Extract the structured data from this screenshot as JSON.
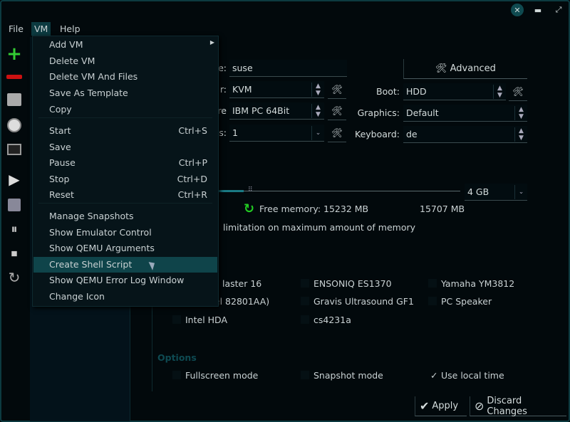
{
  "window": {
    "close_icon": "close-icon",
    "minimize_icon": "minimize-icon",
    "maximize_icon": "maximize-icon",
    "accent": "#0f444a"
  },
  "menubar": {
    "file": "File",
    "vm": "VM",
    "help": "Help"
  },
  "toolbar": {
    "icons": [
      "add-icon",
      "remove-icon",
      "hard-disk-icon",
      "clock-icon",
      "terminal-icon",
      "play-icon",
      "save-icon",
      "pause-icon",
      "stop-icon",
      "reset-icon"
    ]
  },
  "vm_menu": {
    "items": [
      {
        "label": "Add VM",
        "shortcut": "",
        "submenu": true
      },
      {
        "label": "Delete VM",
        "shortcut": ""
      },
      {
        "label": "Delete VM And Files",
        "shortcut": ""
      },
      {
        "label": "Save As Template",
        "shortcut": ""
      },
      {
        "label": "Copy",
        "shortcut": ""
      },
      {
        "label": "Start",
        "shortcut": "Ctrl+S"
      },
      {
        "label": "Save",
        "shortcut": ""
      },
      {
        "label": "Pause",
        "shortcut": "Ctrl+P"
      },
      {
        "label": "Stop",
        "shortcut": "Ctrl+D"
      },
      {
        "label": "Reset",
        "shortcut": "Ctrl+R"
      },
      {
        "label": "Manage Snapshots",
        "shortcut": ""
      },
      {
        "label": "Show Emulator Control",
        "shortcut": ""
      },
      {
        "label": "Show QEMU Arguments",
        "shortcut": ""
      },
      {
        "label": "Create Shell Script",
        "shortcut": "",
        "highlighted": true
      },
      {
        "label": "Show QEMU Error Log Window",
        "shortcut": ""
      },
      {
        "label": "Change Icon",
        "shortcut": ""
      }
    ]
  },
  "form": {
    "name_label_fragment": "e:",
    "name_value": "suse",
    "emulator_label_fragment": "r:",
    "emulator_value": "KVM",
    "machine_label_fragment": "re",
    "machine_value": "IBM PC 64Bit",
    "cpu_label_fragment": "s:",
    "cpu_value": "1",
    "advanced_button": "Advanced",
    "boot_label": "Boot:",
    "boot_value": "HDD",
    "graphics_label": "Graphics:",
    "graphics_value": "Default",
    "keyboard_label": "Keyboard:",
    "keyboard_value": "de"
  },
  "memory": {
    "value": "4 GB",
    "free_memory": "Free memory: 15232 MB",
    "max": "15707 MB",
    "limit_text_fragment": "limitation on maximum amount of memory",
    "slider_fraction": 0.26
  },
  "audio": {
    "items": [
      {
        "label": "laster 16",
        "checked": false
      },
      {
        "label": "ENSONIQ ES1370",
        "checked": false
      },
      {
        "label": "Yamaha YM3812",
        "checked": false
      },
      {
        "label": "tel 82801AA)",
        "checked": false
      },
      {
        "label": "Gravis Ultrasound GF1",
        "checked": false
      },
      {
        "label": "PC Speaker",
        "checked": false
      },
      {
        "label": "Intel HDA",
        "checked": false
      },
      {
        "label": "cs4231a",
        "checked": false
      }
    ]
  },
  "options": {
    "heading": "Options",
    "fullscreen": "Fullscreen mode",
    "snapshot": "Snapshot mode",
    "local_time": "Use local time",
    "local_time_check": "✓"
  },
  "buttons": {
    "apply": "Apply",
    "discard": "Discard Changes"
  }
}
